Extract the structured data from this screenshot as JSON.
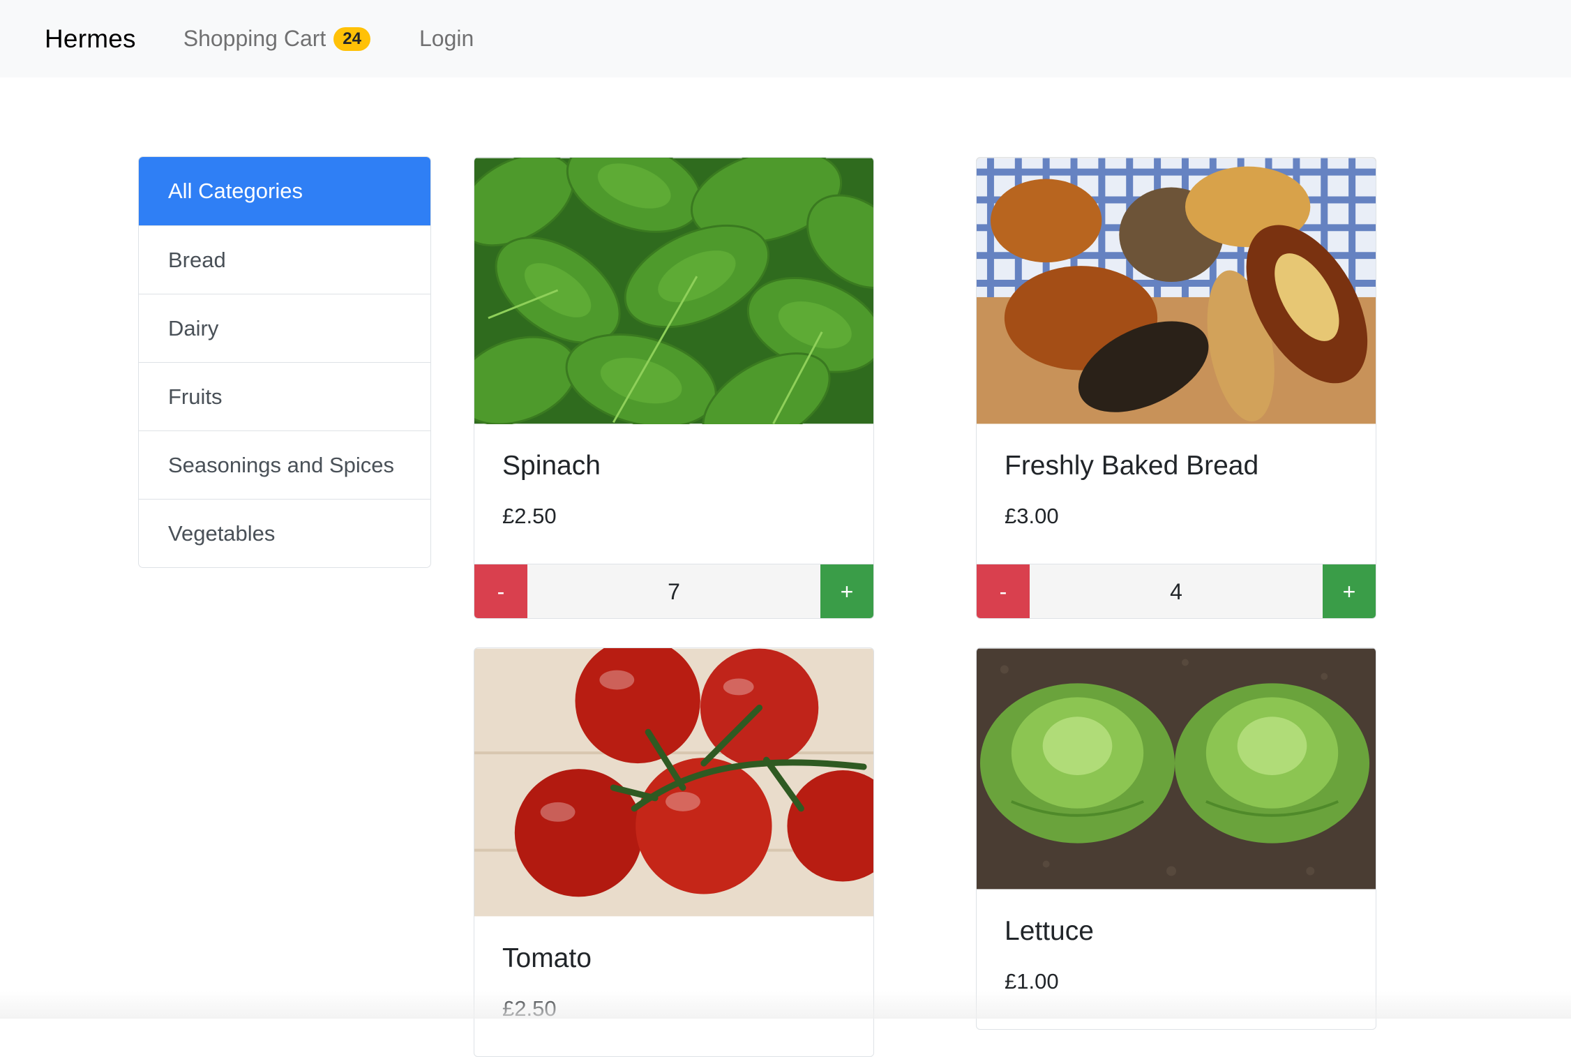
{
  "navbar": {
    "brand": "Hermes",
    "cart_label": "Shopping Cart",
    "cart_count": "24",
    "login_label": "Login"
  },
  "sidebar": {
    "items": [
      {
        "label": "All Categories",
        "active": true
      },
      {
        "label": "Bread",
        "active": false
      },
      {
        "label": "Dairy",
        "active": false
      },
      {
        "label": "Fruits",
        "active": false
      },
      {
        "label": "Seasonings and Spices",
        "active": false
      },
      {
        "label": "Vegetables",
        "active": false
      }
    ]
  },
  "products": [
    {
      "name": "Spinach",
      "price": "£2.50",
      "quantity": "7",
      "image": "spinach-image"
    },
    {
      "name": "Freshly Baked Bread",
      "price": "£3.00",
      "quantity": "4",
      "image": "bread-image"
    },
    {
      "name": "Tomato",
      "price": "£2.50",
      "image": "tomato-image"
    },
    {
      "name": "Lettuce",
      "price": "£1.00",
      "image": "lettuce-image"
    }
  ],
  "buttons": {
    "minus": "-",
    "plus": "+"
  },
  "colors": {
    "accent": "#2f7ff5",
    "badge": "#ffc107",
    "minus": "#d9404e",
    "plus": "#3a9d48"
  }
}
